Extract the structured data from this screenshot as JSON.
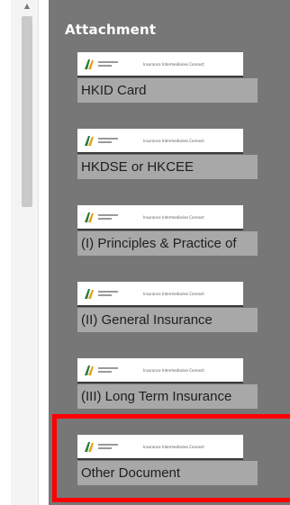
{
  "panel": {
    "title": "Attachment"
  },
  "thumbnail": {
    "caption": "Insurance Intermediaries Connect",
    "logo_icon": "ia-logo-icon"
  },
  "attachments": [
    {
      "label": "HKID Card"
    },
    {
      "label": "HKDSE or HKCEE"
    },
    {
      "label": "(I) Principles & Practice of"
    },
    {
      "label": "(II) General Insurance"
    },
    {
      "label": "(III) Long Term Insurance"
    },
    {
      "label": "Other Document"
    }
  ],
  "colors": {
    "panel_bg": "#777777",
    "label_bg": "#a8a8a8",
    "highlight": "#ff0000"
  }
}
